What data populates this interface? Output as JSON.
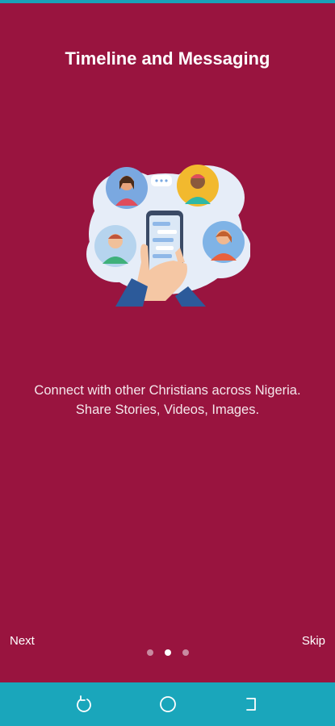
{
  "screen": {
    "title": "Timeline and Messaging",
    "caption_line1": "Connect with other Christians across Nigeria.",
    "caption_line2": "Share Stories, Videos, Images."
  },
  "controls": {
    "next_label": "Next",
    "skip_label": "Skip"
  },
  "pager": {
    "page_count": 3,
    "active_index": 1
  },
  "illustration": {
    "icon": "people-messaging-illustration"
  },
  "navbar": {
    "icons": [
      "back-icon",
      "home-icon",
      "recents-icon"
    ]
  },
  "colors": {
    "background": "#99143f",
    "navbar": "#1aa6bb",
    "text": "#ffffff"
  }
}
